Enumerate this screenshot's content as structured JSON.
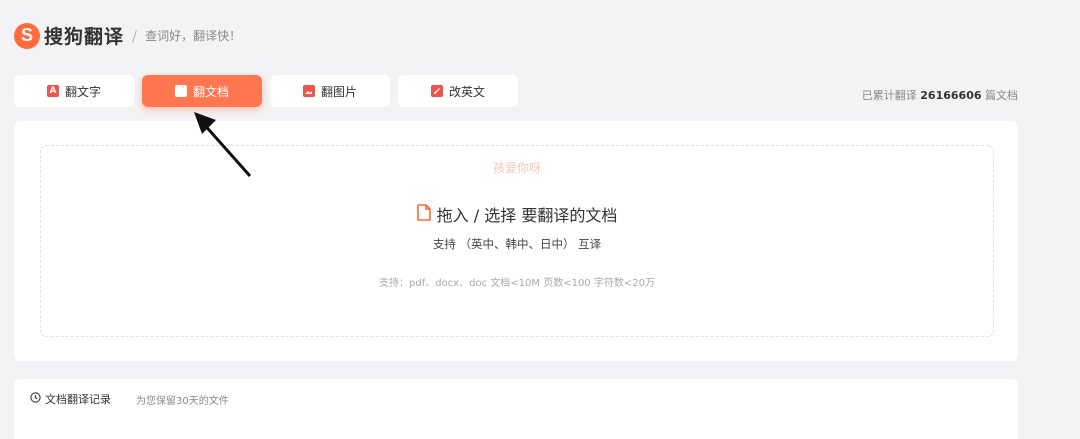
{
  "logo": {
    "mark": "S",
    "brand": "搜狗翻译",
    "slogan": "查词好，翻译快！"
  },
  "tabs": [
    {
      "label": "翻文字",
      "icon": "text-translate-icon",
      "active": false
    },
    {
      "label": "翻文档",
      "icon": "document-icon",
      "active": true
    },
    {
      "label": "翻图片",
      "icon": "image-icon",
      "active": false
    },
    {
      "label": "改英文",
      "icon": "edit-english-icon",
      "active": false
    }
  ],
  "counter": {
    "prefix": "已累计翻译",
    "value": "26166606",
    "suffix": "篇文档"
  },
  "upload": {
    "watermark": "孩爱你呀",
    "title": "拖入 / 选择 要翻译的文档",
    "support": "支持  （英中、韩中、日中） 互译",
    "limits": "支持：pdf、docx、doc    文档<10M  页数<100  字符数<20万"
  },
  "history": {
    "title": "文档翻译记录",
    "note": "为您保留30天的文件"
  },
  "colors": {
    "accent": "#ff7651",
    "brand": "#ff6b3d"
  }
}
